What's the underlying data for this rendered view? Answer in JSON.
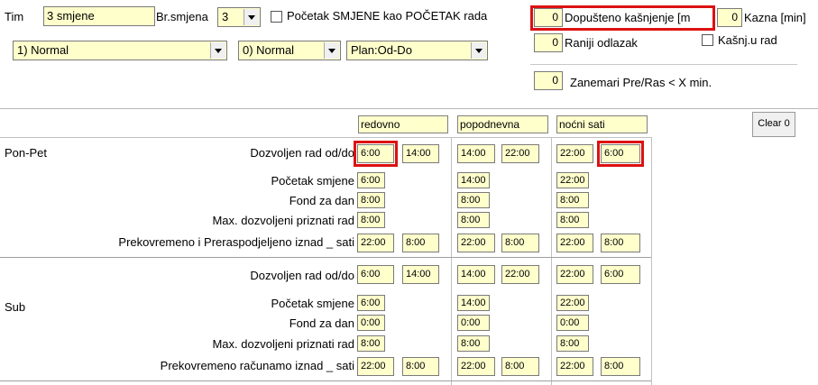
{
  "top": {
    "tim_label": "Tim",
    "tim_value": "3 smjene",
    "br_smjena_label": "Br.smjena",
    "br_smjena_value": "3",
    "pocetak_checkbox_label": "Početak SMJENE kao POČETAK rada",
    "combo1": "1) Normal",
    "combo2": "0) Normal",
    "combo3": "Plan:Od-Do"
  },
  "right_panel": {
    "dopusteno_value": "0",
    "dopusteno_label": "Dopušteno kašnjenje [m",
    "kazna_value": "0",
    "kazna_label": "Kazna [min]",
    "raniji_value": "0",
    "raniji_label": "Raniji odlazak",
    "kasnj_label": "Kašnj.u rad",
    "zanemari_value": "0",
    "zanemari_label": "Zanemari Pre/Ras < X min."
  },
  "grid": {
    "headers": [
      "redovno",
      "popodnevna",
      "noćni sati"
    ],
    "clear_button": "Clear 0",
    "sections": [
      {
        "name": "Pon-Pet",
        "rows": [
          {
            "label": "Dozvoljen rad od/do",
            "cells": [
              "6:00",
              "14:00",
              "14:00",
              "22:00",
              "22:00",
              "6:00"
            ]
          },
          {
            "label": "Početak smjene",
            "cells": [
              "6:00",
              "",
              "14:00",
              "",
              "22:00",
              ""
            ]
          },
          {
            "label": "Fond za dan",
            "cells": [
              "8:00",
              "",
              "8:00",
              "",
              "8:00",
              ""
            ]
          },
          {
            "label": "Max. dozvoljeni priznati rad",
            "cells": [
              "8:00",
              "",
              "8:00",
              "",
              "8:00",
              ""
            ]
          },
          {
            "label": "Prekovremeno i Preraspodjeljeno iznad _ sati",
            "cells": [
              "22:00",
              "8:00",
              "22:00",
              "8:00",
              "22:00",
              "8:00"
            ]
          }
        ]
      },
      {
        "name": "Sub",
        "rows": [
          {
            "label": "Dozvoljen rad od/do",
            "cells": [
              "6:00",
              "14:00",
              "14:00",
              "22:00",
              "22:00",
              "6:00"
            ]
          },
          {
            "label": "Početak smjene",
            "cells": [
              "6:00",
              "",
              "14:00",
              "",
              "22:00",
              ""
            ]
          },
          {
            "label": "Fond za dan",
            "cells": [
              "0:00",
              "",
              "0:00",
              "",
              "0:00",
              ""
            ]
          },
          {
            "label": "Max. dozvoljeni priznati rad",
            "cells": [
              "8:00",
              "",
              "8:00",
              "",
              "8:00",
              ""
            ]
          },
          {
            "label": "Prekovremeno računamo iznad _ sati",
            "cells": [
              "22:00",
              "8:00",
              "22:00",
              "8:00",
              "22:00",
              "8:00"
            ]
          }
        ]
      }
    ]
  }
}
